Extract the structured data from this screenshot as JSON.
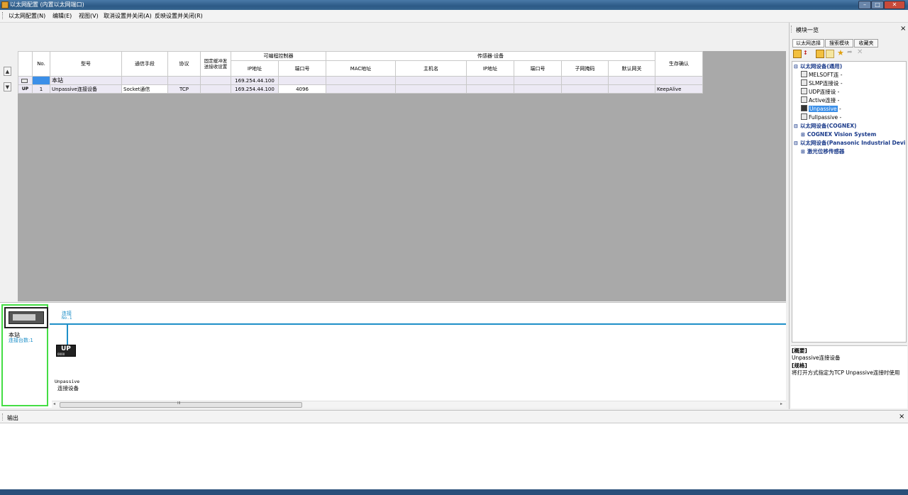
{
  "window": {
    "title": "以太网配置 (内置以太网端口)",
    "buttons": [
      "–",
      "□",
      "✕"
    ]
  },
  "menu": [
    "以太网配置(N)",
    "编辑(E)",
    "视图(V)",
    "取消设置并关闭(A)",
    "反映设置并关闭(R)"
  ],
  "grid": {
    "headers": {
      "no": "No.",
      "model": "型号",
      "comm": "通信手段",
      "protocol": "协议",
      "fixed": "固定缓冲发送接收设置",
      "plc_group": "可编程控制器",
      "sensor_group": "传感器·设备",
      "ip": "IP地址",
      "port": "端口号",
      "mac": "MAC地址",
      "host": "主机名",
      "sensor_ip": "IP地址",
      "sensor_port": "端口号",
      "subnet": "子网掩码",
      "gateway": "默认网关",
      "alive": "生存确认"
    },
    "station_row": {
      "label": "本站",
      "ip": "169.254.44.100"
    },
    "device_row": {
      "no": "1",
      "model": "Unpassive连接设备",
      "comm": "Socket通信",
      "protocol": "TCP",
      "ip": "169.254.44.100",
      "port": "4096",
      "alive": "KeepAlive"
    }
  },
  "diagram": {
    "connection_label": "连接",
    "connection_no": "No.1",
    "station_label": "本站",
    "station_count": "连接台数:1",
    "device_badge": "UP",
    "device_badge_sub": "0000",
    "device_name_line1": "Unpassive",
    "device_name_line2": "连接设备",
    "scroll_mark": "III"
  },
  "module_panel": {
    "title": "模块一览",
    "close": "×",
    "tabs": [
      "以太网选择",
      "搜索模块",
      "收藏夹"
    ],
    "tree": [
      {
        "label": "以太网设备(通用)",
        "kind": "category"
      },
      {
        "label": "MELSOFT连",
        "kind": "item"
      },
      {
        "label": "SLMP连接设",
        "kind": "item"
      },
      {
        "label": "UDP连接设",
        "kind": "item"
      },
      {
        "label": "Active连接",
        "kind": "item"
      },
      {
        "label": "Unpassive",
        "kind": "item-selected"
      },
      {
        "label": "Fullpassive",
        "kind": "item"
      },
      {
        "label": "以太网设备(COGNEX)",
        "kind": "category"
      },
      {
        "label": "COGNEX Vision System",
        "kind": "subcategory"
      },
      {
        "label": "以太网设备(Panasonic Industrial Devi",
        "kind": "category"
      },
      {
        "label": "激光位移传感器",
        "kind": "subcategory"
      }
    ],
    "description": {
      "summary_label": "[概要]",
      "summary": "Unpassive连接设备",
      "spec_label": "[规格]",
      "spec": "将打开方式指定为TCP Unpassive连接时使用"
    }
  },
  "output": {
    "title": "输出",
    "close": "×"
  },
  "colors": {
    "accent_blue": "#1e8fc8",
    "selection": "#3b8fe8",
    "green_frame": "#44dd44",
    "category_text": "#1a3a8a"
  }
}
